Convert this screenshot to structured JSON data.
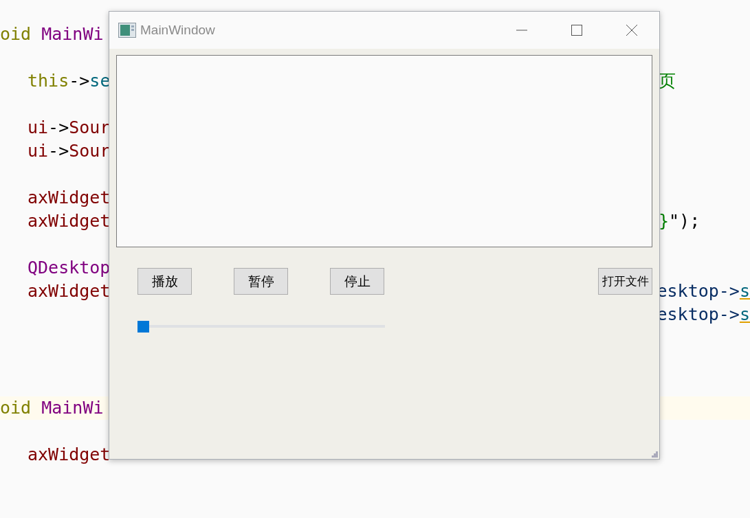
{
  "editor": {
    "lines": [
      {
        "kind": "code",
        "left": [
          {
            "kind": "keyword",
            "text": "oid"
          },
          {
            "kind": "type",
            "text": " MainWi"
          }
        ]
      },
      {
        "kind": "blank"
      },
      {
        "kind": "code",
        "left": [
          {
            "kind": "keyword",
            "text": "this"
          },
          {
            "kind": "plain",
            "text": "->"
          },
          {
            "kind": "method",
            "text": "se"
          }
        ],
        "right": [
          {
            "kind": "string",
            "text": "页"
          }
        ]
      },
      {
        "kind": "blank"
      },
      {
        "kind": "code",
        "left": [
          {
            "kind": "member",
            "text": "ui"
          },
          {
            "kind": "plain",
            "text": "->"
          },
          {
            "kind": "member",
            "text": "Sour"
          }
        ]
      },
      {
        "kind": "code",
        "left": [
          {
            "kind": "member",
            "text": "ui"
          },
          {
            "kind": "plain",
            "text": "->"
          },
          {
            "kind": "member",
            "text": "Sour"
          }
        ]
      },
      {
        "kind": "blank"
      },
      {
        "kind": "code",
        "left": [
          {
            "kind": "member",
            "text": "axWidget"
          }
        ]
      },
      {
        "kind": "code",
        "left": [
          {
            "kind": "member",
            "text": "axWidget"
          }
        ],
        "right": [
          {
            "kind": "string",
            "text": "}"
          },
          {
            "kind": "plain",
            "text": "\");"
          }
        ]
      },
      {
        "kind": "blank"
      },
      {
        "kind": "code",
        "left": [
          {
            "kind": "type",
            "text": "QDesktop"
          }
        ]
      },
      {
        "kind": "code",
        "left": [
          {
            "kind": "member",
            "text": "axWidget"
          }
        ],
        "right": [
          {
            "kind": "local",
            "text": "esktop->"
          },
          {
            "kind": "call",
            "text": "s"
          }
        ]
      },
      {
        "kind": "code",
        "right": [
          {
            "kind": "local",
            "text": "esktop->"
          },
          {
            "kind": "call",
            "text": "s"
          }
        ]
      },
      {
        "kind": "blank"
      },
      {
        "kind": "blank"
      },
      {
        "kind": "blank"
      },
      {
        "kind": "code",
        "current": true,
        "left": [
          {
            "kind": "keyword",
            "text": "oid"
          },
          {
            "kind": "type",
            "text": " MainWi"
          }
        ]
      },
      {
        "kind": "blank"
      },
      {
        "kind": "code",
        "left": [
          {
            "kind": "member",
            "text": "axWidget"
          }
        ]
      }
    ]
  },
  "window": {
    "title": "MainWindow",
    "buttons": [
      {
        "label": "播放"
      },
      {
        "label": "暂停"
      },
      {
        "label": "停止"
      },
      {
        "label": "打开文件"
      }
    ],
    "slider": {
      "level": 0
    }
  }
}
